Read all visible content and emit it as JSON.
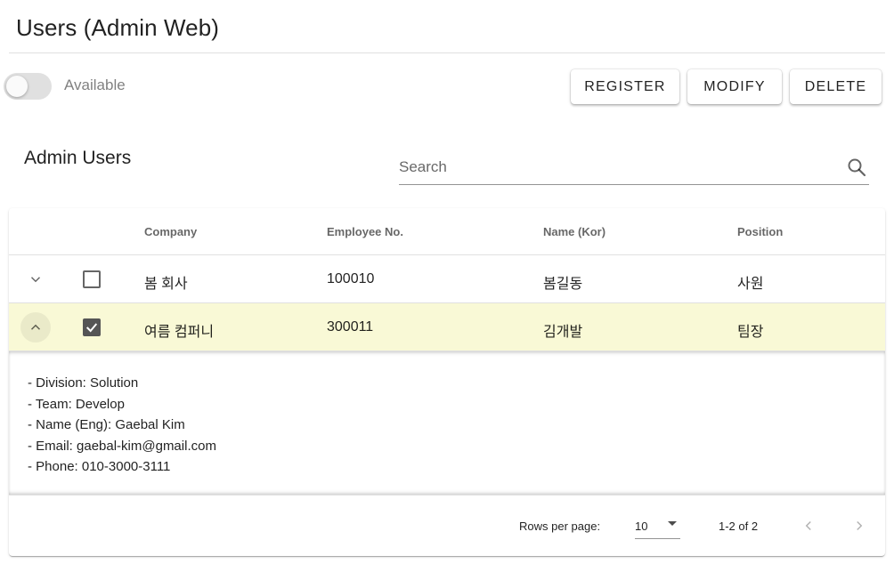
{
  "header": {
    "title": "Users (Admin Web)"
  },
  "toggle": {
    "label": "Available",
    "checked": false
  },
  "toolbar": {
    "register_label": "REGISTER",
    "modify_label": "MODIFY",
    "delete_label": "DELETE"
  },
  "section": {
    "title": "Admin Users"
  },
  "search": {
    "placeholder": "Search",
    "value": "",
    "icon": "search-icon"
  },
  "table": {
    "columns": [
      "Company",
      "Employee No.",
      "Name (Kor)",
      "Position"
    ],
    "rows": [
      {
        "company": "봄 회사",
        "employee_no": "100010",
        "name_kor": "봄길동",
        "position": "사원",
        "expanded": false,
        "selected": false
      },
      {
        "company": "여름 컴퍼니",
        "employee_no": "300011",
        "name_kor": "김개발",
        "position": "팀장",
        "expanded": true,
        "selected": true
      }
    ],
    "details": [
      "- Division: Solution",
      "- Team: Develop",
      "- Name (Eng): Gaebal Kim",
      "- Email: gaebal-kim@gmail.com",
      "- Phone: 010-3000-3111"
    ]
  },
  "pagination": {
    "rows_per_page_label": "Rows per page:",
    "rows_per_page_value": "10",
    "range_text": "1-2 of 2"
  },
  "colors": {
    "selected_row_bg": "#f9f9d6",
    "checkbox_checked": "#555555",
    "toggle_track": "#e0e0e0"
  }
}
